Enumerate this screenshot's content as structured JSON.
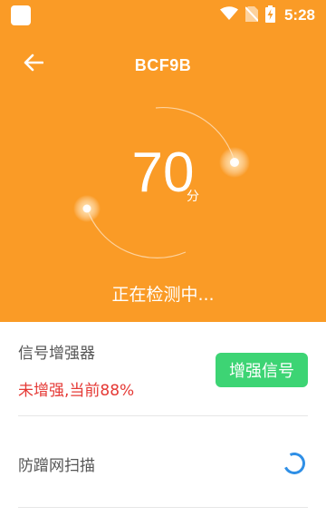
{
  "status_bar": {
    "time": "5:28",
    "icons": [
      "app-notification-icon",
      "wifi-icon",
      "no-sim-icon",
      "battery-charging-icon"
    ]
  },
  "header": {
    "title": "BCF9B",
    "back_icon": "arrow-left-icon",
    "background_color": "#FA9B26"
  },
  "gauge": {
    "score": "70",
    "unit": "分",
    "status_text": "正在检测中..."
  },
  "booster": {
    "label": "信号增强器",
    "status": "未增强,当前88%",
    "button_label": "增强信号",
    "button_color": "#3DD474",
    "status_color": "#E53935"
  },
  "anti_leech": {
    "label": "防蹭网扫描",
    "indicator": "loading-spinner-icon",
    "indicator_color": "#2F8FE6"
  }
}
